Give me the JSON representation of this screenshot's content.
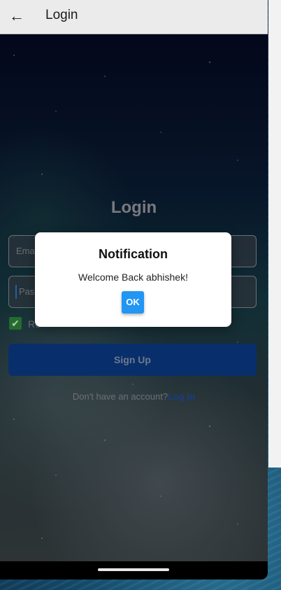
{
  "appbar": {
    "title": "Login"
  },
  "form": {
    "heading": "Login",
    "email_placeholder": "Ema",
    "password_placeholder": "Pass",
    "remember_label": "Re",
    "signup_label": "Sign Up",
    "account_prompt": "Don't have an account?",
    "login_link": "Log In"
  },
  "dialog": {
    "title": "Notification",
    "message": "Welcome Back abhishek!",
    "ok_label": "OK"
  },
  "icons": {
    "back": "arrow-left-icon",
    "checkbox": "checkmark-icon"
  },
  "colors": {
    "primary_button": "#0b3d8a",
    "ok_button": "#2196f3",
    "link": "#1f4fae",
    "checkbox": "#2e8b3c"
  }
}
